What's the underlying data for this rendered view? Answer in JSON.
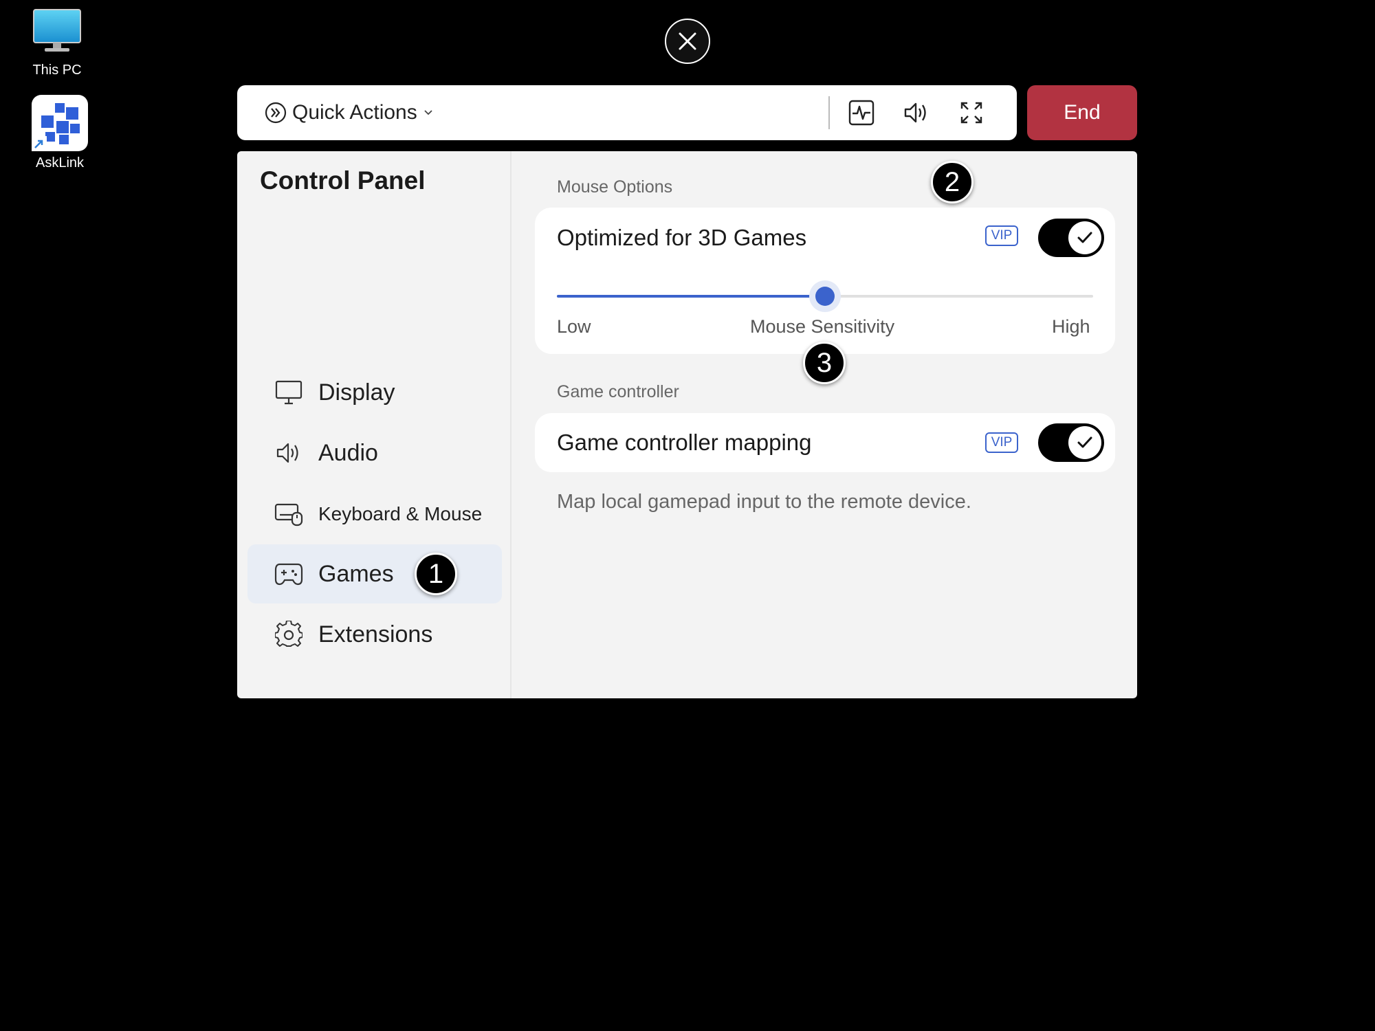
{
  "desktop": {
    "icons": [
      {
        "label": "This PC"
      },
      {
        "label": "AskLink"
      }
    ]
  },
  "toolbar": {
    "quick_actions_label": "Quick Actions",
    "end_label": "End",
    "icons": [
      "performance-icon",
      "volume-icon",
      "fullscreen-icon"
    ]
  },
  "control_panel": {
    "title": "Control Panel",
    "nav": [
      {
        "label": "Display",
        "icon": "monitor-icon"
      },
      {
        "label": "Audio",
        "icon": "speaker-icon"
      },
      {
        "label": "Keyboard & Mouse",
        "icon": "keyboard-mouse-icon"
      },
      {
        "label": "Games",
        "icon": "gamepad-icon",
        "active": true
      },
      {
        "label": "Extensions",
        "icon": "gear-icon"
      }
    ]
  },
  "mouse_options": {
    "section_label": "Mouse Options",
    "optimized_label": "Optimized for 3D Games",
    "vip_label": "VIP",
    "toggle_on": true,
    "sensitivity": {
      "low_label": "Low",
      "label": "Mouse Sensitivity",
      "high_label": "High",
      "value_fraction": 0.5
    }
  },
  "game_controller": {
    "section_label": "Game controller",
    "mapping_label": "Game controller mapping",
    "vip_label": "VIP",
    "toggle_on": true,
    "description": "Map local gamepad input to the remote device."
  },
  "callouts": [
    "1",
    "2",
    "3"
  ],
  "colors": {
    "accent": "#3b63cc",
    "end_button": "#b23341",
    "toggle_bg": "#000000"
  }
}
